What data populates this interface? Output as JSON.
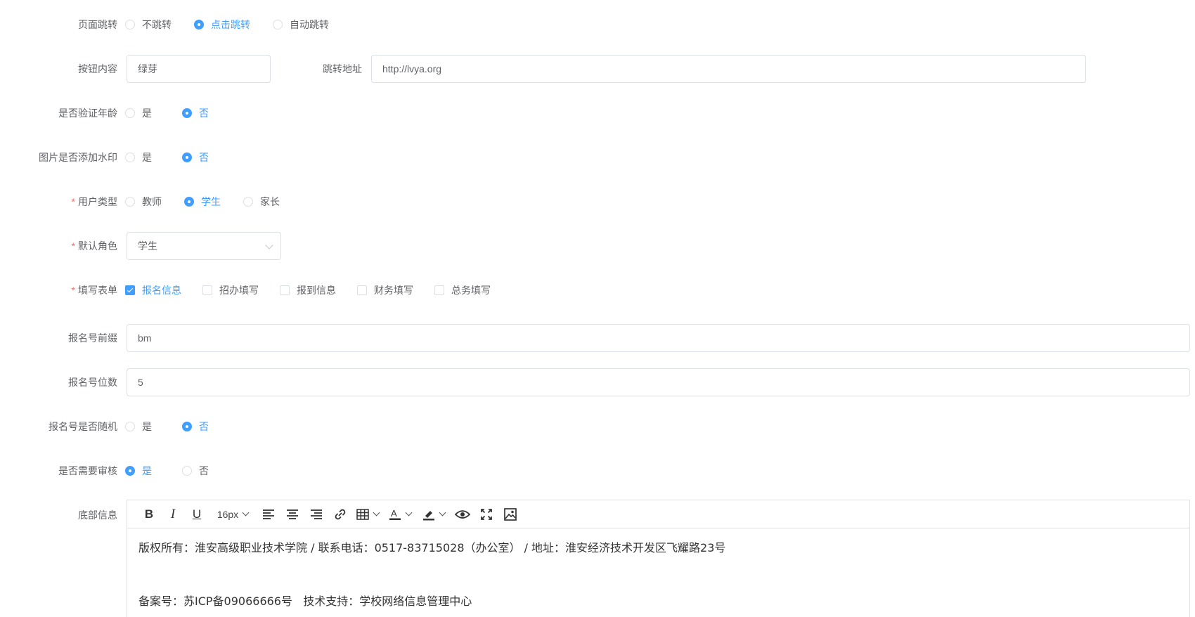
{
  "page_jump": {
    "label": "页面跳转",
    "options": [
      "不跳转",
      "点击跳转",
      "自动跳转"
    ],
    "selected": 1
  },
  "button_content": {
    "label": "按钮内容",
    "value": "绿芽"
  },
  "jump_url": {
    "label": "跳转地址",
    "value": "http://lvya.org"
  },
  "verify_age": {
    "label": "是否验证年龄",
    "options": [
      "是",
      "否"
    ],
    "selected": 1
  },
  "watermark": {
    "label": "图片是否添加水印",
    "options": [
      "是",
      "否"
    ],
    "selected": 1
  },
  "user_type": {
    "required_mark": "*",
    "label": "用户类型",
    "options": [
      "教师",
      "学生",
      "家长"
    ],
    "selected": 1
  },
  "default_role": {
    "required_mark": "*",
    "label": "默认角色",
    "value": "学生"
  },
  "forms": {
    "required_mark": "*",
    "label": "填写表单",
    "options": [
      "报名信息",
      "招办填写",
      "报到信息",
      "财务填写",
      "总务填写"
    ],
    "checked": [
      true,
      false,
      false,
      false,
      false
    ]
  },
  "reg_prefix": {
    "label": "报名号前缀",
    "value": "bm"
  },
  "reg_digits": {
    "label": "报名号位数",
    "value": "5"
  },
  "reg_random": {
    "label": "报名号是否随机",
    "options": [
      "是",
      "否"
    ],
    "selected": 1
  },
  "need_review": {
    "label": "是否需要审核",
    "options": [
      "是",
      "否"
    ],
    "selected": 0
  },
  "footer_info": {
    "label": "底部信息",
    "font_size": "16px",
    "line1": "版权所有：淮安高级职业技术学院 / 联系电话：0517-83715028（办公室） / 地址：淮安经济技术开发区飞耀路23号",
    "line2": "备案号：苏ICP备09066666号   技术支持：学校网络信息管理中心"
  },
  "colors": {
    "accent": "#409eff",
    "required": "#f56c6c",
    "border": "#dcdfe6"
  }
}
